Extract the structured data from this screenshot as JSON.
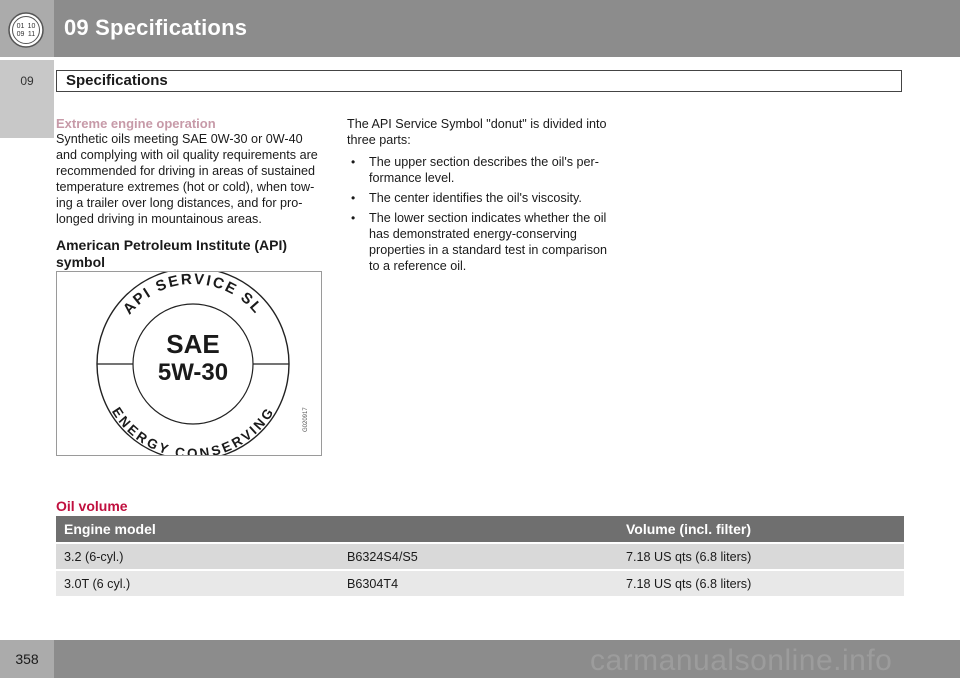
{
  "header": {
    "chapter_title": "09 Specifications",
    "icon_digits": [
      "01",
      "10",
      "09",
      "11"
    ]
  },
  "side_tab": {
    "label": "09"
  },
  "section": {
    "title": "Specifications"
  },
  "left_column": {
    "extreme_heading": "Extreme engine operation",
    "extreme_text": "Synthetic oils meeting SAE 0W-30 or 0W-40 and complying with oil quality requirements are recommended for driving in areas of sustained temperature extremes (hot or cold), when tow-ing a trailer over long distances, and for pro-longed driving in mountainous areas.",
    "api_heading": "American Petroleum Institute (API) symbol"
  },
  "api_symbol": {
    "top_text": "API SERVICE SL",
    "center_line1": "SAE",
    "center_line2": "5W-30",
    "bottom_text": "ENERGY CONSERVING",
    "image_code": "G020917"
  },
  "right_column": {
    "intro": "The API Service Symbol \"donut\" is divided into three parts:",
    "bullets": [
      "The upper section describes the oil's per-formance level.",
      "The center identifies the oil's viscosity.",
      "The lower section indicates whether the oil has demonstrated energy-conserving properties in a standard test in comparison to a reference oil."
    ]
  },
  "oil_volume": {
    "title": "Oil volume",
    "headers": [
      "Engine model",
      "Volume (incl. filter)"
    ],
    "rows": [
      [
        "3.2 (6-cyl.)",
        "B6324S4/S5",
        "7.18 US qts (6.8 liters)"
      ],
      [
        "3.0T (6 cyl.)",
        "B6304T4",
        "7.18 US qts (6.8 liters)"
      ]
    ]
  },
  "footer": {
    "page_number": "358",
    "watermark": "carmanualsonline.info"
  },
  "colors": {
    "header_gray": "#8c8c8c",
    "tab_gray": "#ababab",
    "subhead_pink": "#c79aa8",
    "oil_title_red": "#c0103f",
    "table_header": "#6f6f6f"
  }
}
